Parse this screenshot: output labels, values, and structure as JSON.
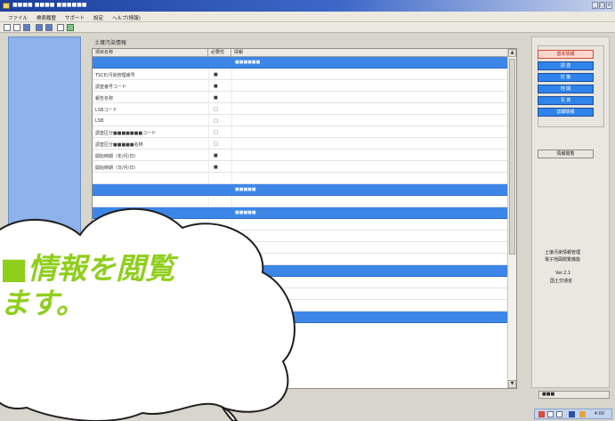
{
  "window": {
    "title": "■■■■ ■■■■ ■■■■■■"
  },
  "menu": {
    "items": [
      "ファイル",
      "検索履歴",
      "サポート",
      "設定",
      "ヘルプ(情報)"
    ]
  },
  "panel": {
    "label": "土壌汚染情報"
  },
  "grid": {
    "headers": [
      "項目名称",
      "必要性",
      "情報"
    ],
    "rows": [
      {
        "type": "section",
        "name": "",
        "mark": "",
        "info": "■■■■■■"
      },
      {
        "type": "data",
        "name": "TSCE/汚染管理番号",
        "mark": "■",
        "info": ""
      },
      {
        "type": "data",
        "name": "調査番号コード",
        "mark": "■",
        "info": ""
      },
      {
        "type": "data",
        "name": "報告名称",
        "mark": "■",
        "info": ""
      },
      {
        "type": "data",
        "name": "LSBコード",
        "mark": "□",
        "info": ""
      },
      {
        "type": "data",
        "name": "LSB",
        "mark": "□",
        "info": ""
      },
      {
        "type": "data",
        "name": "調査区分■■■■■■■コード",
        "mark": "□",
        "info": ""
      },
      {
        "type": "data",
        "name": "調査区分■■■■■名称",
        "mark": "□",
        "info": ""
      },
      {
        "type": "data",
        "name": "開始時期（年/月/日）",
        "mark": "■",
        "info": ""
      },
      {
        "type": "data",
        "name": "開始時期（日/月/日）",
        "mark": "■",
        "info": ""
      },
      {
        "type": "data",
        "name": "",
        "mark": "",
        "info": ""
      },
      {
        "type": "section",
        "name": "",
        "mark": "",
        "info": "■■■■■"
      },
      {
        "type": "data",
        "name": "",
        "mark": "",
        "info": ""
      },
      {
        "type": "section",
        "name": "",
        "mark": "",
        "info": "■■■■■"
      },
      {
        "type": "data",
        "name": "",
        "mark": "",
        "info": ""
      },
      {
        "type": "data",
        "name": "",
        "mark": "",
        "info": ""
      },
      {
        "type": "data",
        "name": "",
        "mark": "",
        "info": ""
      },
      {
        "type": "data",
        "name": "",
        "mark": "",
        "info": ""
      },
      {
        "type": "section",
        "name": "",
        "mark": "",
        "info": ""
      },
      {
        "type": "data",
        "name": "",
        "mark": "",
        "info": ""
      },
      {
        "type": "data",
        "name": "",
        "mark": "",
        "info": ""
      },
      {
        "type": "data",
        "name": "",
        "mark": "",
        "info": ""
      },
      {
        "type": "section",
        "name": "",
        "mark": "",
        "info": ""
      }
    ]
  },
  "sidebar": {
    "buttons": [
      {
        "label": "基本情報",
        "style": "red"
      },
      {
        "label": "調 査",
        "style": "blue"
      },
      {
        "label": "対 策",
        "style": "blue"
      },
      {
        "label": "地 図",
        "style": "blue"
      },
      {
        "label": "写 真",
        "style": "blue"
      },
      {
        "label": "詳細情報",
        "style": "blue"
      },
      {
        "label": "情報閲覧",
        "style": "gray"
      }
    ],
    "info_line1": "土壌汚染情報管理",
    "info_line2": "電子地図閲覧機能",
    "info_version": "Ver.2.1",
    "info_org": "国土交通省"
  },
  "status": {
    "field": "■■■",
    "clock": "4:00"
  },
  "bubble": {
    "text": "■情報を閲覧\nます。"
  },
  "colors": {
    "accent": "#3d86e8",
    "bubble_text": "#8fcf1c",
    "left_pane": "#8eb2ec"
  }
}
